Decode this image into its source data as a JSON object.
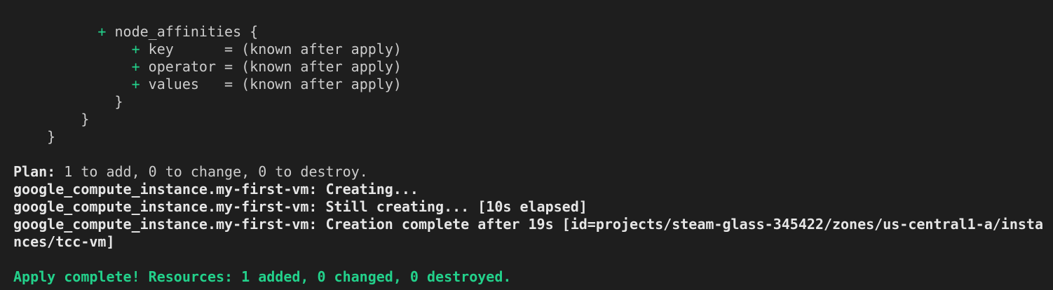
{
  "terminal": {
    "plan_block": {
      "node_affinities_line": {
        "plus": "+",
        "text": " node_affinities {"
      },
      "key_line": {
        "plus": "+",
        "text": " key      = (known after apply)"
      },
      "operator_line": {
        "plus": "+",
        "text": " operator = (known after apply)"
      },
      "values_line": {
        "plus": "+",
        "text": " values   = (known after apply)"
      },
      "close_inner": "}",
      "close_mid": "}",
      "close_outer": "}"
    },
    "plan_summary": {
      "label": "Plan:",
      "text": " 1 to add, 0 to change, 0 to destroy."
    },
    "apply_lines": [
      "google_compute_instance.my-first-vm: Creating...",
      "google_compute_instance.my-first-vm: Still creating... [10s elapsed]",
      "google_compute_instance.my-first-vm: Creation complete after 19s [id=projects/steam-glass-345422/zones/us-central1-a/insta",
      "nces/tcc-vm]"
    ],
    "result": "Apply complete! Resources: 1 added, 0 changed, 0 destroyed.",
    "colors": {
      "background": "#1e1e1e",
      "text": "#cccccc",
      "plus": "#23d18b",
      "success": "#23d18b"
    }
  }
}
